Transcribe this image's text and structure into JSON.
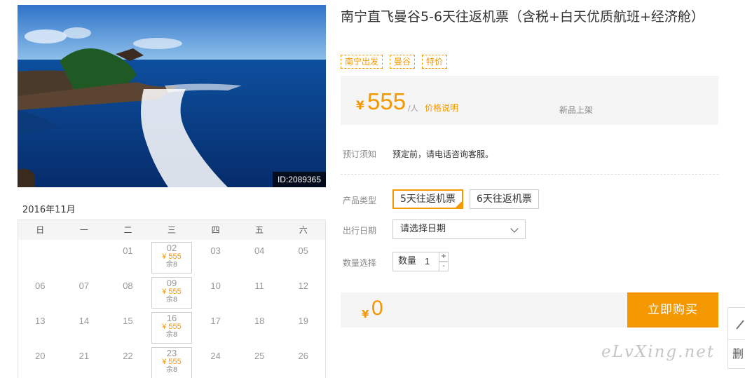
{
  "photo": {
    "id_label": "ID:2089365"
  },
  "calendar": {
    "month": "2016年11月",
    "weekdays": [
      "日",
      "一",
      "二",
      "三",
      "四",
      "五",
      "六"
    ],
    "rows": [
      [
        {
          "d": ""
        },
        {
          "d": ""
        },
        {
          "d": "01"
        },
        {
          "d": "02",
          "price": "¥ 555",
          "stock": "余8"
        },
        {
          "d": "03"
        },
        {
          "d": "04"
        },
        {
          "d": "05"
        }
      ],
      [
        {
          "d": "06"
        },
        {
          "d": "07"
        },
        {
          "d": "08"
        },
        {
          "d": "09",
          "price": "¥ 555",
          "stock": "余8"
        },
        {
          "d": "10"
        },
        {
          "d": "11"
        },
        {
          "d": "12"
        }
      ],
      [
        {
          "d": "13"
        },
        {
          "d": "14"
        },
        {
          "d": "15"
        },
        {
          "d": "16",
          "price": "¥ 555",
          "stock": "余8"
        },
        {
          "d": "17"
        },
        {
          "d": "18"
        },
        {
          "d": "19"
        }
      ],
      [
        {
          "d": "20"
        },
        {
          "d": "21"
        },
        {
          "d": "22"
        },
        {
          "d": "23",
          "price": "¥ 555",
          "stock": "余8"
        },
        {
          "d": "24"
        },
        {
          "d": "25"
        },
        {
          "d": "26"
        }
      ]
    ]
  },
  "product": {
    "title": "南宁直飞曼谷5-6天往返机票（含税+白天优质航班+经济舱）",
    "tags": [
      "南宁出发",
      "曼谷",
      "特价"
    ]
  },
  "price": {
    "currency": "¥",
    "value": "555",
    "unit": "/人",
    "note_link": "价格说明",
    "new_label": "新品上架"
  },
  "booking": {
    "notice_label": "预订须知",
    "notice_text": "预定前，请电话咨询客服。",
    "type_label": "产品类型",
    "types": [
      "5天往返机票",
      "6天往返机票"
    ],
    "selected_type": 0,
    "date_label": "出行日期",
    "date_placeholder": "请选择日期",
    "qty_label": "数量选择",
    "qty_text": "数量",
    "qty_value": "1",
    "plus": "+",
    "minus": "-"
  },
  "total": {
    "currency": "¥",
    "value": "0",
    "buy_label": "立即购买"
  },
  "watermark": "eLvXing.net",
  "side": {
    "label": "删"
  },
  "colors": {
    "accent": "#f39800",
    "panel": "#f5f5f5"
  }
}
